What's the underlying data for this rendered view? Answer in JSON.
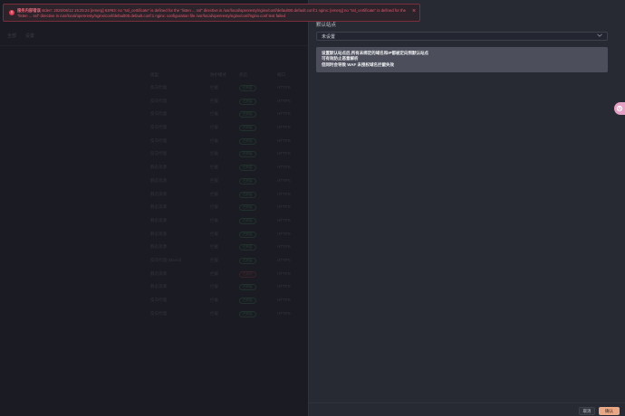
{
  "toast": {
    "title": "服务内部错误",
    "message": "stderr: 2025/06/12 15:25:24 [emerg] 63#63: no \"ssl_certificate\" is defined for the \"listen ... ssl\" directive in /usr/local/openresty/nginx/conf/default00.default.conf:1 nginx: [emerg] no \"ssl_certificate\" is defined for the \"listen ... ssl\" directive in /usr/local/openresty/nginx/conf/default00.default.conf:1 nginx: configuration file /usr/local/openresty/nginx/conf/nginx.conf test failed"
  },
  "background": {
    "tabs": [
      "全部",
      "设置"
    ],
    "columns": [
      "类型",
      "防护模式",
      "状态",
      "端口"
    ],
    "rows": [
      {
        "type": "反向代理",
        "mode": "拦截",
        "status": "已开启",
        "port": "HTTPS",
        "status_color": "green"
      },
      {
        "type": "反向代理",
        "mode": "拦截",
        "status": "已开启",
        "port": "HTTPS",
        "status_color": "green"
      },
      {
        "type": "反向代理",
        "mode": "拦截",
        "status": "已开启",
        "port": "HTTPS",
        "status_color": "green"
      },
      {
        "type": "反向代理",
        "mode": "拦截",
        "status": "已开启",
        "port": "HTTPS",
        "status_color": "green"
      },
      {
        "type": "反向代理",
        "mode": "拦截",
        "status": "已开启",
        "port": "HTTPS",
        "status_color": "green"
      },
      {
        "type": "反向代理",
        "mode": "拦截",
        "status": "已开启",
        "port": "HTTPS",
        "status_color": "green"
      },
      {
        "type": "静态资源",
        "mode": "拦截",
        "status": "已开启",
        "port": "HTTPS",
        "status_color": "green"
      },
      {
        "type": "静态资源",
        "mode": "拦截",
        "status": "已开启",
        "port": "HTTPS",
        "status_color": "green"
      },
      {
        "type": "静态资源",
        "mode": "拦截",
        "status": "已开启",
        "port": "HTTPS",
        "status_color": "green"
      },
      {
        "type": "静态资源",
        "mode": "拦截",
        "status": "已开启",
        "port": "HTTPS",
        "status_color": "green"
      },
      {
        "type": "静态资源",
        "mode": "拦截",
        "status": "已开启",
        "port": "HTTPS",
        "status_color": "green"
      },
      {
        "type": "静态资源",
        "mode": "拦截",
        "status": "已开启",
        "port": "HTTPS",
        "status_color": "green"
      },
      {
        "type": "静态资源",
        "mode": "拦截",
        "status": "已开启",
        "port": "HTTPS",
        "status_color": "green"
      },
      {
        "type": "反向代理 (Mixed)",
        "mode": "拦截",
        "status": "已开启",
        "port": "HTTPS",
        "status_color": "green"
      },
      {
        "type": "静态资源",
        "mode": "拦截",
        "status": "已关闭",
        "port": "HTTPS",
        "status_color": "red"
      },
      {
        "type": "静态资源",
        "mode": "拦截",
        "status": "已开启",
        "port": "HTTPS",
        "status_color": "green"
      },
      {
        "type": "反向代理",
        "mode": "拦截",
        "status": "已开启",
        "port": "HTTPS",
        "status_color": "green"
      },
      {
        "type": "反向代理",
        "mode": "拦截",
        "status": "已开启",
        "port": "HTTPS",
        "status_color": "green"
      }
    ]
  },
  "drawer": {
    "label": "默认站点",
    "select_value": "未设置",
    "info_lines": [
      "设置默认站点后,所有未绑定的域名和IP都被定向到默认站点",
      "可有效防止恶意解析",
      "但同时会导致 WAF 未授权域名拦截失效"
    ],
    "cancel_label": "取消",
    "ok_label": "确认"
  },
  "colors": {
    "accent": "#e8a886",
    "error": "#e23a52",
    "info_box": "#4c4f5b",
    "float_button": "#e6a0c4"
  },
  "icons": {
    "toast": "error-circle-icon",
    "close": "close-icon",
    "select": "chevron-down-icon",
    "float": "assistant-icon"
  }
}
